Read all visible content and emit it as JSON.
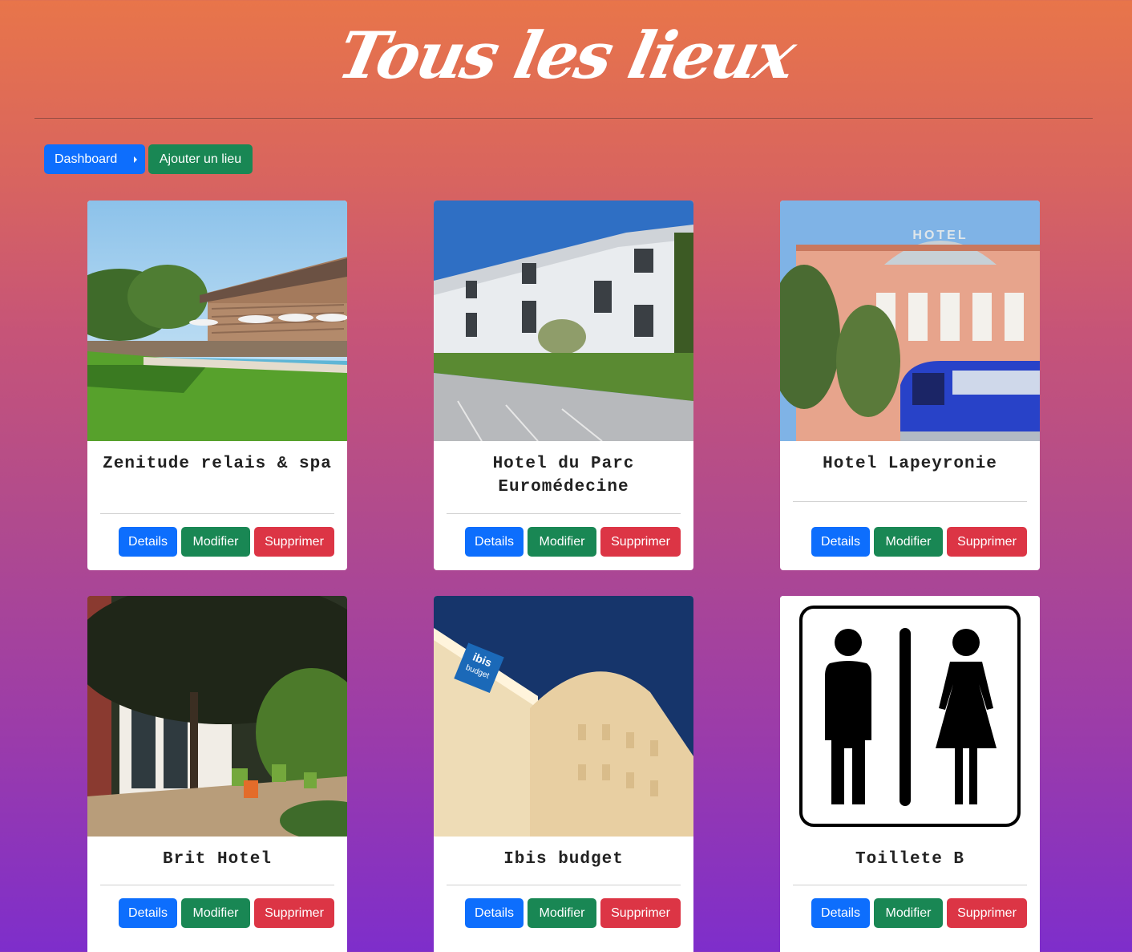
{
  "page": {
    "title": "Tous les lieux"
  },
  "toolbar": {
    "dashboard_label": "Dashboard",
    "add_label": "Ajouter un lieu"
  },
  "actions": {
    "details": "Details",
    "modifier": "Modifier",
    "supprimer": "Supprimer"
  },
  "cards": [
    {
      "title": "Zenitude relais & spa",
      "image": "hotel-pool-photo"
    },
    {
      "title": "Hotel du Parc Euromédecine",
      "image": "hotel-building-photo"
    },
    {
      "title": "Hotel Lapeyronie",
      "image": "hotel-tram-photo"
    },
    {
      "title": "Brit Hotel",
      "image": "hotel-terrace-photo"
    },
    {
      "title": "Ibis budget",
      "image": "ibis-budget-photo"
    },
    {
      "title": "Toillete B",
      "image": "restroom-sign-icon"
    }
  ],
  "ibis_logo": {
    "line1": "ibis",
    "line2": "budget"
  },
  "hotel_sign": "HOTEL",
  "colors": {
    "primary": "#0d6efd",
    "success": "#198754",
    "danger": "#dc3545"
  }
}
